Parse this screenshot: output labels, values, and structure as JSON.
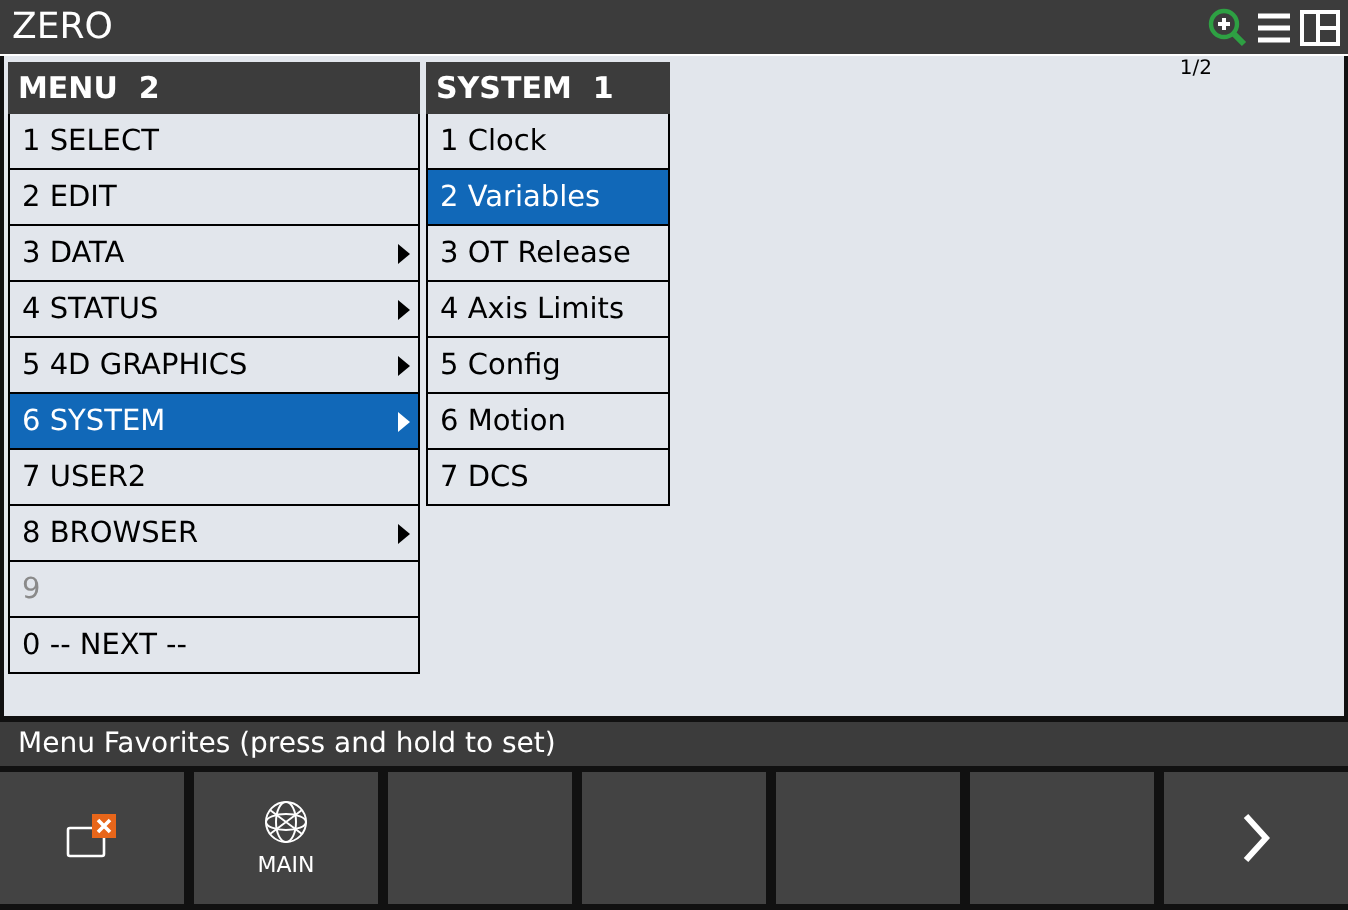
{
  "window": {
    "title": "ZERO"
  },
  "page_indicator": "1/2",
  "menu": {
    "title": "MENU  2",
    "items": [
      {
        "label": "1 SELECT",
        "submenu": false,
        "selected": false,
        "disabled": false
      },
      {
        "label": "2 EDIT",
        "submenu": false,
        "selected": false,
        "disabled": false
      },
      {
        "label": "3 DATA",
        "submenu": true,
        "selected": false,
        "disabled": false
      },
      {
        "label": "4 STATUS",
        "submenu": true,
        "selected": false,
        "disabled": false
      },
      {
        "label": "5 4D GRAPHICS",
        "submenu": true,
        "selected": false,
        "disabled": false
      },
      {
        "label": "6 SYSTEM",
        "submenu": true,
        "selected": true,
        "disabled": false
      },
      {
        "label": "7 USER2",
        "submenu": false,
        "selected": false,
        "disabled": false
      },
      {
        "label": "8 BROWSER",
        "submenu": true,
        "selected": false,
        "disabled": false
      },
      {
        "label": "9",
        "submenu": false,
        "selected": false,
        "disabled": true
      },
      {
        "label": "0 -- NEXT --",
        "submenu": false,
        "selected": false,
        "disabled": false
      }
    ]
  },
  "submenu": {
    "title": "SYSTEM  1",
    "items": [
      {
        "label": "1 Clock",
        "selected": false
      },
      {
        "label": "2 Variables",
        "selected": true
      },
      {
        "label": "3 OT Release",
        "selected": false
      },
      {
        "label": "4 Axis Limits",
        "selected": false
      },
      {
        "label": "5 Config",
        "selected": false
      },
      {
        "label": "6 Motion",
        "selected": false
      },
      {
        "label": "7 DCS",
        "selected": false
      }
    ]
  },
  "status_bar": "Menu Favorites (press and hold to set)",
  "function_keys": [
    {
      "kind": "close-window"
    },
    {
      "kind": "main",
      "label": "MAIN"
    },
    {
      "kind": "empty"
    },
    {
      "kind": "empty"
    },
    {
      "kind": "empty"
    },
    {
      "kind": "empty"
    },
    {
      "kind": "next"
    }
  ]
}
